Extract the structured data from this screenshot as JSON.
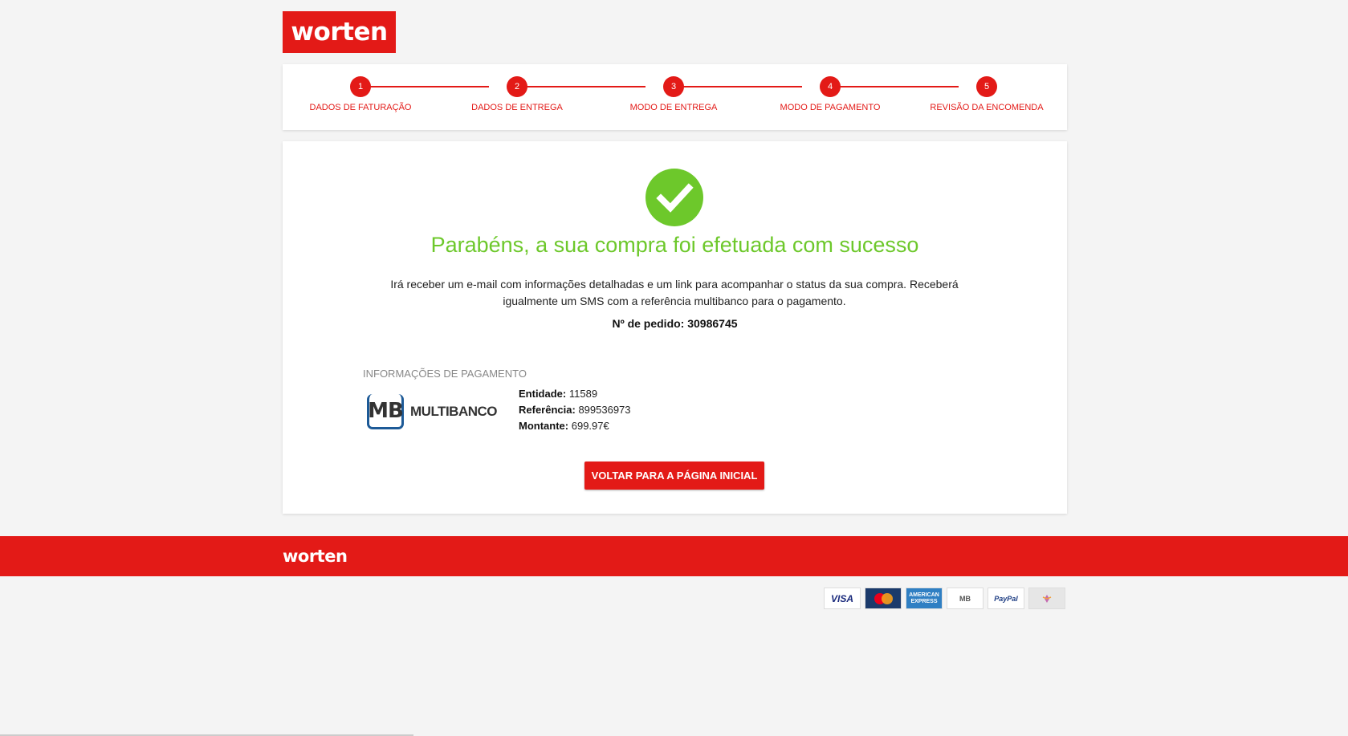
{
  "brand": {
    "logo": "worten",
    "color": "#e31a17"
  },
  "steps": [
    {
      "number": "1",
      "label": "DADOS DE FATURAÇÃO"
    },
    {
      "number": "2",
      "label": "DADOS DE ENTREGA"
    },
    {
      "number": "3",
      "label": "MODO DE ENTREGA"
    },
    {
      "number": "4",
      "label": "MODO DE PAGAMENTO"
    },
    {
      "number": "5",
      "label": "REVISÃO DA ENCOMENDA"
    }
  ],
  "confirmation": {
    "icon": "checkmark-icon",
    "success_color": "#6dc82b",
    "title": "Parabéns, a sua compra foi efetuada com sucesso",
    "message": "Irá receber um e-mail com informações detalhadas e um link para acompanhar o status da sua compra. Receberá igualmente um SMS com a referência multibanco para o pagamento.",
    "order_label": "Nº de pedido:",
    "order_number": "30986745"
  },
  "payment": {
    "heading": "INFORMAÇÕES DE PAGAMENTO",
    "method_logo_mark": "MB",
    "method_name": "MULTIBANCO",
    "entity_label": "Entidade:",
    "entity_value": "11589",
    "reference_label": "Referência:",
    "reference_value": "899536973",
    "amount_label": "Montante:",
    "amount_value": "699.97€"
  },
  "cta": {
    "label": "VOLTAR PARA A PÁGINA INICIAL"
  },
  "footer": {
    "logo": "worten",
    "payment_cards": [
      {
        "name": "visa-card-icon",
        "text": "VISA"
      },
      {
        "name": "mastercard-card-icon",
        "text": ""
      },
      {
        "name": "amex-card-icon",
        "text": "AMERICAN EXPRESS"
      },
      {
        "name": "multibanco-card-icon",
        "text": "MB"
      },
      {
        "name": "paypal-card-icon",
        "text": "PayPal"
      },
      {
        "name": "universo-card-icon",
        "text": ""
      }
    ]
  }
}
